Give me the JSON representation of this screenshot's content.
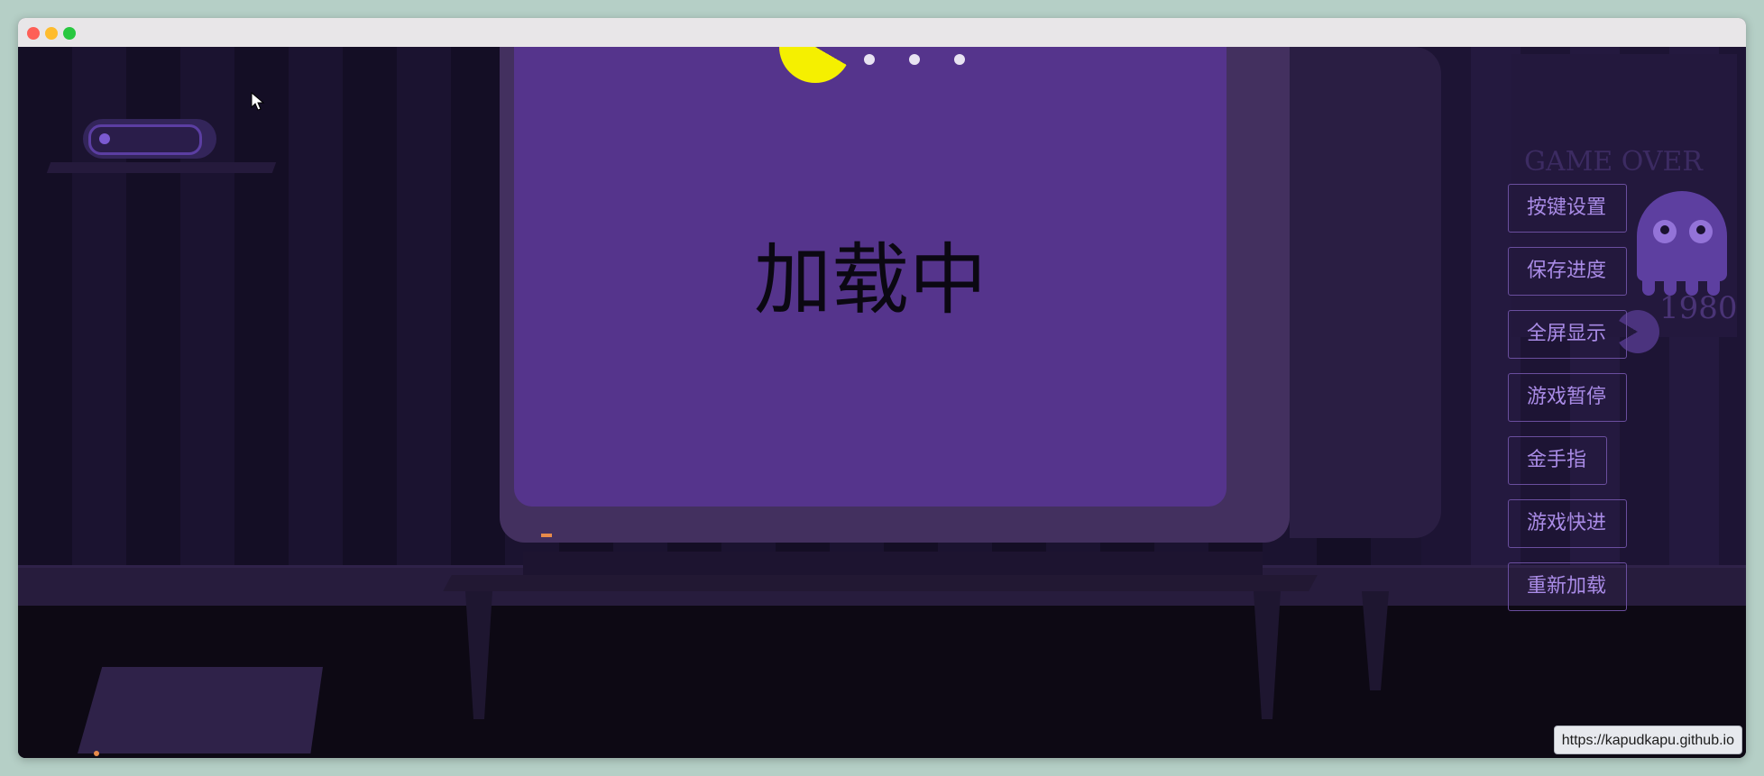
{
  "window": {
    "controls": [
      "close",
      "minimize",
      "zoom"
    ]
  },
  "scene": {
    "poster": {
      "title": "GAME OVER",
      "year": "1980"
    },
    "screen": {
      "loading_text": "加载中"
    }
  },
  "menu": {
    "items": [
      {
        "label": "按键设置"
      },
      {
        "label": "保存进度"
      },
      {
        "label": "全屏显示"
      },
      {
        "label": "游戏暂停"
      },
      {
        "label": "金手指"
      },
      {
        "label": "游戏快进"
      },
      {
        "label": "重新加载"
      }
    ]
  },
  "status_bar": {
    "url": "https://kapudkapu.github.io"
  },
  "colors": {
    "accent": "#a98be6",
    "screen": "#55348c",
    "pacman": "#f5f000"
  },
  "icons": [
    "pacman-icon",
    "ghost-icon",
    "cursor-icon",
    "controller-icon",
    "console-icon"
  ]
}
